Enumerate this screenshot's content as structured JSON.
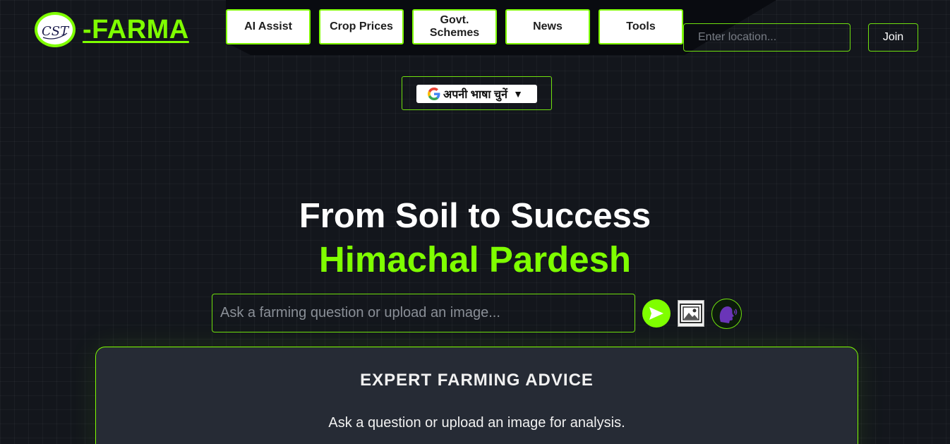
{
  "brand": {
    "logo_mark": "CST",
    "name": "-FARMA",
    "accent_color": "#7fff00"
  },
  "nav": {
    "items": [
      {
        "label": "AI Assist"
      },
      {
        "label": "Crop Prices"
      },
      {
        "label": "Govt. Schemes"
      },
      {
        "label": "News"
      },
      {
        "label": "Tools"
      }
    ]
  },
  "location": {
    "placeholder": "Enter location...",
    "value": ""
  },
  "join": {
    "label": "Join"
  },
  "language": {
    "label": "अपनी भाषा चुनें",
    "caret": "▼",
    "icon": "google-g-icon"
  },
  "hero": {
    "line1": "From Soil to Success",
    "line2": "Himachal Pardesh"
  },
  "query": {
    "placeholder": "Ask a farming question or upload an image...",
    "value": "",
    "send_icon": "send-arrow-icon",
    "image_icon": "image-upload-icon",
    "voice_icon": "voice-speaking-head-icon"
  },
  "advice": {
    "title": "EXPERT FARMING ADVICE",
    "text": "Ask a question or upload an image for analysis."
  }
}
